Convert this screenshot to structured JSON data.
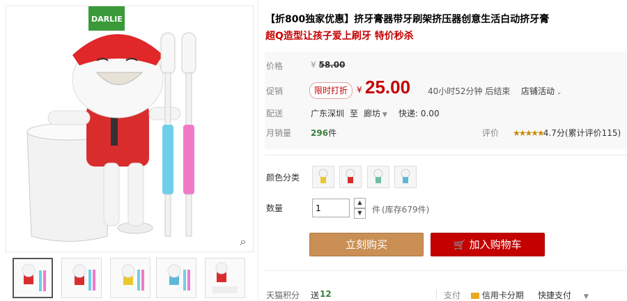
{
  "product": {
    "title": "【折800独家优惠】挤牙膏器带牙刷架挤压器创意生活白动挤牙膏",
    "subtitle": "超Q造型让孩子爱上刷牙 特价秒杀"
  },
  "price": {
    "label": "价格",
    "currency": "¥",
    "original": "58.00"
  },
  "promo": {
    "label": "促销",
    "badge": "限时打折",
    "currency": "¥",
    "price": "25.00",
    "countdown": "40小时52分钟 后结束",
    "shop_activity": "店铺活动"
  },
  "shipping": {
    "label": "配送",
    "from": "广东深圳",
    "to_word": "至",
    "to": "廊坊",
    "express": "快递: 0.00"
  },
  "sales": {
    "label": "月销量",
    "count": "296",
    "unit": "件",
    "rating_label": "评价",
    "stars": "★★★★★",
    "rating_text": "4.7分(累计评价115)"
  },
  "color": {
    "label": "颜色分类",
    "options": [
      "yellow",
      "red",
      "green",
      "blue"
    ]
  },
  "quantity": {
    "label": "数量",
    "value": "1",
    "unit": "件",
    "stock": "(库存679件)"
  },
  "buttons": {
    "buy": "立刻购买",
    "cart": "加入购物车"
  },
  "bottom": {
    "points_label": "天猫积分",
    "points_prefix": "送",
    "points_value": "12",
    "pay_label": "支付",
    "credit_card": "信用卡分期",
    "fast_pay": "快捷支付"
  },
  "colors": {
    "accent": "#c40000",
    "buy": "#c98f55",
    "points": "#3a7e3a"
  }
}
